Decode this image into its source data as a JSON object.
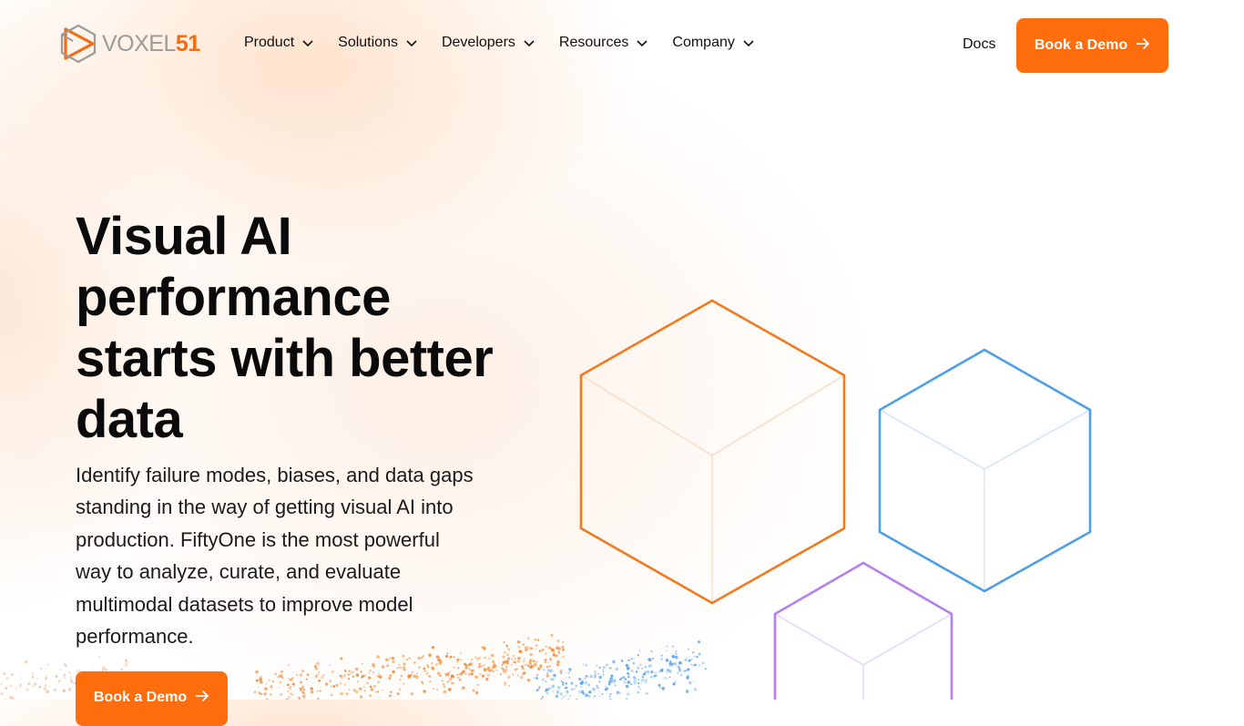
{
  "brand": {
    "wordmark_part1": "VOXEL",
    "wordmark_part2": "51",
    "logo_icon": "voxel51-play-cube-icon",
    "accent_color": "#ff6d0c"
  },
  "nav": {
    "items": [
      {
        "label": "Product",
        "icon": "chevron-down-icon"
      },
      {
        "label": "Solutions",
        "icon": "chevron-down-icon"
      },
      {
        "label": "Developers",
        "icon": "chevron-down-icon"
      },
      {
        "label": "Resources",
        "icon": "chevron-down-icon"
      },
      {
        "label": "Company",
        "icon": "chevron-down-icon"
      }
    ],
    "docs_label": "Docs",
    "cta_label": "Book a Demo",
    "cta_icon": "arrow-right-icon"
  },
  "hero": {
    "title": "Visual AI performance starts with better data",
    "subtitle": "Identify failure modes, biases, and data gaps standing in the way of getting visual AI into production. FiftyOne is the most powerful way to analyze, curate, and evaluate multimodal datasets to improve model performance.",
    "cta_label": "Book a Demo",
    "cta_icon": "arrow-right-icon"
  },
  "illustration": {
    "cube_colors": {
      "orange": "#ef7a1f",
      "blue": "#4f9fe6",
      "purple": "#b57ff0"
    },
    "particle_colors": [
      "#f08a35",
      "#f6a563",
      "#5aa3e8",
      "#9cc7f0"
    ]
  }
}
